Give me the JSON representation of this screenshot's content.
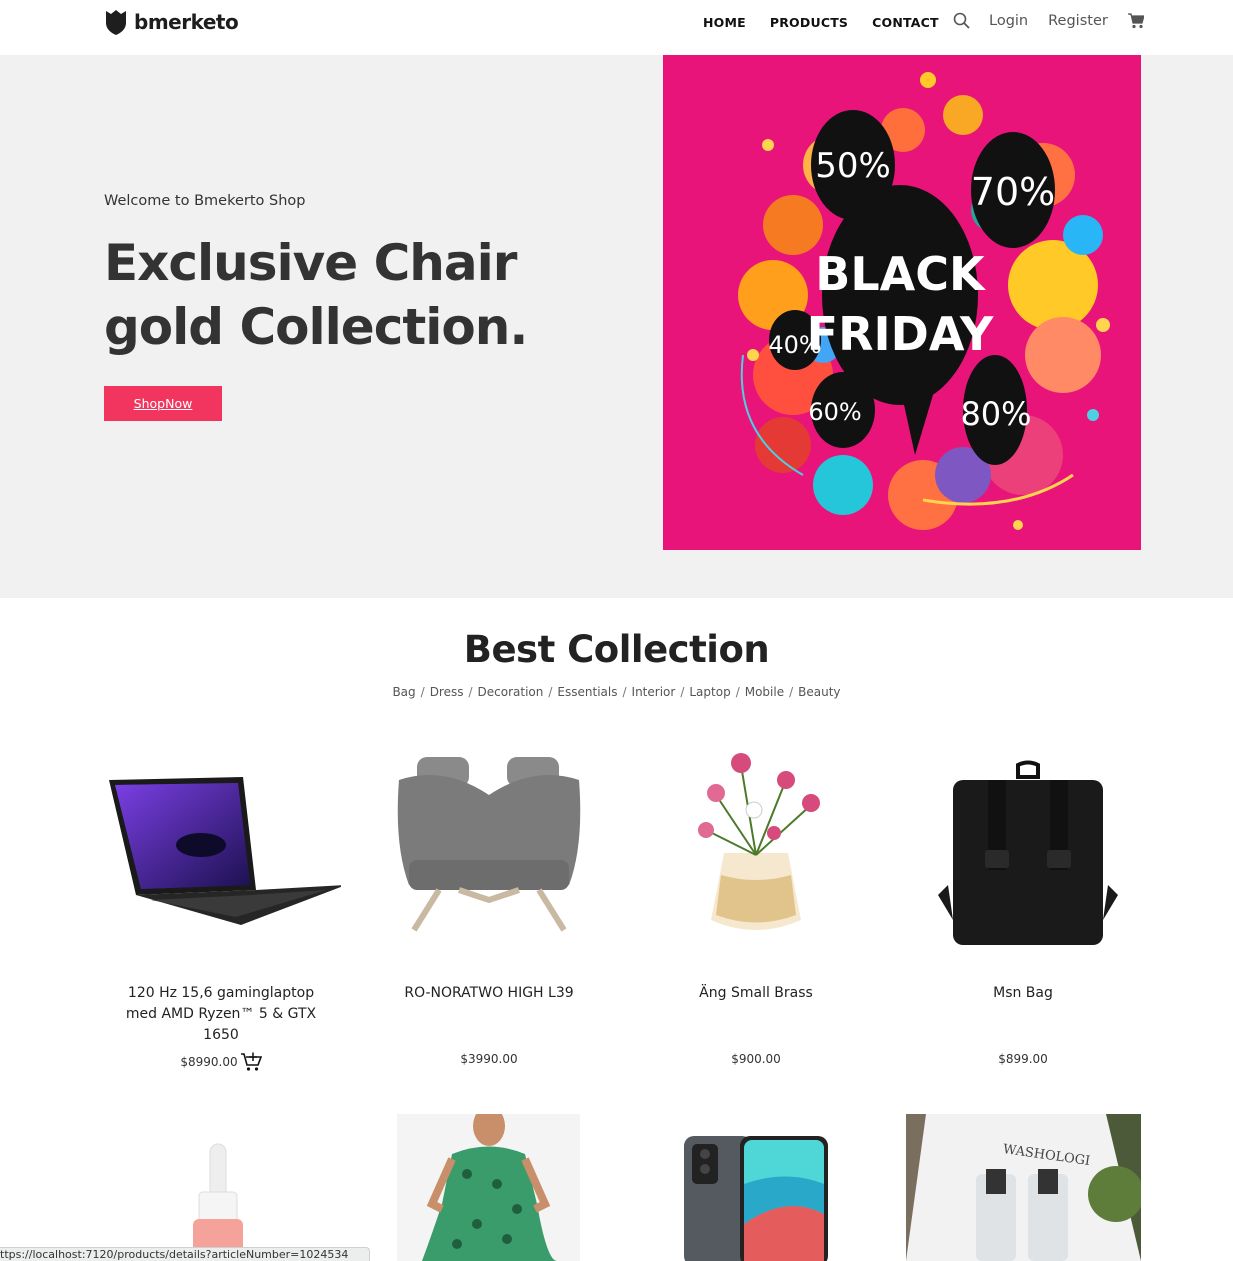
{
  "brand": {
    "name": "bmerketo"
  },
  "nav": {
    "links": [
      "HOME",
      "PRODUCTS",
      "CONTACT"
    ],
    "login": "Login",
    "register": "Register"
  },
  "hero": {
    "welcome": "Welcome to Bmekerto Shop",
    "title_line1": "Exclusive Chair",
    "title_line2": "gold Collection.",
    "button": "ShopNow",
    "banner": {
      "line1": "BLACK",
      "line2": "FRIDAY",
      "discounts": [
        "50%",
        "70%",
        "40%",
        "60%",
        "80%"
      ],
      "background": "#e8147a"
    }
  },
  "collection": {
    "title": "Best Collection",
    "categories": [
      "Bag",
      "Dress",
      "Decoration",
      "Essentials",
      "Interior",
      "Laptop",
      "Mobile",
      "Beauty"
    ]
  },
  "products": [
    {
      "name": "120 Hz 15,6 gaminglaptop med AMD Ryzen™ 5 & GTX 1650",
      "price": "$8990.00",
      "icon": "laptop"
    },
    {
      "name": "RO-NORATWO HIGH L39",
      "price": "$3990.00",
      "icon": "sofa"
    },
    {
      "name": "Äng Small Brass",
      "price": "$900.00",
      "icon": "flower-vase"
    },
    {
      "name": "Msn Bag",
      "price": "$899.00",
      "icon": "backpack"
    }
  ],
  "products_row2": [
    {
      "icon": "serum-bottle"
    },
    {
      "icon": "dress"
    },
    {
      "icon": "mobile-phone"
    },
    {
      "icon": "washologi-box",
      "label": "WASHOLOGI"
    }
  ],
  "status_url": "ttps://localhost:7120/products/details?articleNumber=1024534",
  "colors": {
    "accent": "#f2355e",
    "hero_bg": "#f1f1f1"
  }
}
